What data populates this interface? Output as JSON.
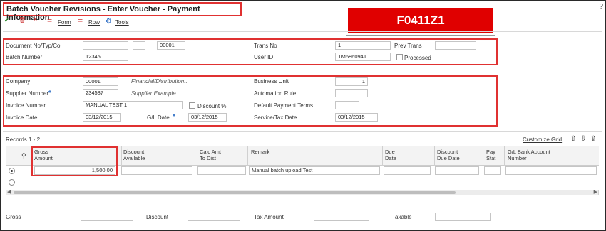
{
  "window": {
    "title": "Batch Voucher Revisions - Enter Voucher - Payment Information",
    "help_label": "?"
  },
  "banner": {
    "text": "F0411Z1"
  },
  "toolbar": {
    "form_label": "Form",
    "row_label": "Row",
    "tools_label": "Tools"
  },
  "header": {
    "document_label": "Document No/Typ/Co",
    "document_no": "",
    "document_type": "",
    "document_co": "00001",
    "trans_no_label": "Trans No",
    "trans_no": "1",
    "prev_trans_label": "Prev Trans",
    "prev_trans": "",
    "batch_number_label": "Batch Number",
    "batch_number": "12345",
    "user_id_label": "User ID",
    "user_id": "TM6860941",
    "processed_label": "Processed"
  },
  "details": {
    "company_label": "Company",
    "company": "00001",
    "company_desc": "Financial/Distribution...",
    "business_unit_label": "Business Unit",
    "business_unit": "1",
    "supplier_number_label": "Supplier Number",
    "supplier_number": "234587",
    "supplier_desc": "Supplier Example",
    "automation_rule_label": "Automation Rule",
    "automation_rule": "",
    "invoice_number_label": "Invoice Number",
    "invoice_number": "MANUAL TEST 1",
    "discount_pct_label": "Discount %",
    "default_payment_terms_label": "Default Payment Terms",
    "default_payment_terms": "",
    "invoice_date_label": "Invoice Date",
    "invoice_date": "03/12/2015",
    "gl_date_label": "G/L Date",
    "gl_date": "03/12/2015",
    "service_tax_date_label": "Service/Tax Date",
    "service_tax_date": "03/12/2015",
    "required_mark": "*"
  },
  "grid": {
    "records_label": "Records 1 - 2",
    "customize_label": "Customize Grid",
    "columns": [
      {
        "line1": "Gross",
        "line2": "Amount"
      },
      {
        "line1": "Discount",
        "line2": "Available"
      },
      {
        "line1": "Calc Amt",
        "line2": "To Dist"
      },
      {
        "line1": "Remark",
        "line2": ""
      },
      {
        "line1": "Due",
        "line2": "Date"
      },
      {
        "line1": "Discount",
        "line2": "Due Date"
      },
      {
        "line1": "Pay",
        "line2": "Stat"
      },
      {
        "line1": "G/L Bank Account",
        "line2": "Number"
      }
    ],
    "rows": [
      {
        "gross_amount": "1,500.00",
        "remark": "Manual batch upload Test"
      }
    ]
  },
  "footer": {
    "gross_label": "Gross",
    "gross": "",
    "discount_label": "Discount",
    "discount": "",
    "tax_amount_label": "Tax Amount",
    "tax_amount": "",
    "taxable_label": "Taxable",
    "taxable": ""
  },
  "colors": {
    "highlight_red": "#e03131",
    "banner_red": "#e00000",
    "accent_blue": "#2b6cc4"
  }
}
